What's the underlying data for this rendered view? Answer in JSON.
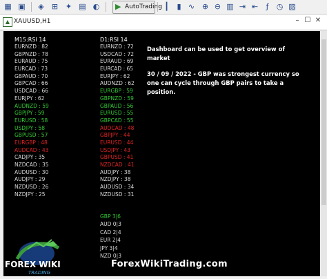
{
  "toolbar": {
    "autotrading_label": "AutoTrading"
  },
  "window": {
    "title": "XAUUSD,H1"
  },
  "dashboard": {
    "m15_header": "M15:RSI 14",
    "d1_header": "D1:RSI 14",
    "m15_rows": [
      {
        "text": "EURNZD : 82",
        "color": "white"
      },
      {
        "text": "GBPNZD : 78",
        "color": "white"
      },
      {
        "text": "EURAUD : 75",
        "color": "white"
      },
      {
        "text": "EURCAD : 73",
        "color": "white"
      },
      {
        "text": "GBPAUD : 70",
        "color": "white"
      },
      {
        "text": "GBPCAD : 66",
        "color": "white"
      },
      {
        "text": "USDCAD : 66",
        "color": "white"
      },
      {
        "text": "EURJPY : 62",
        "color": "white"
      },
      {
        "text": "AUDNZD : 59",
        "color": "green"
      },
      {
        "text": "GBPJPY : 59",
        "color": "green"
      },
      {
        "text": "EURUSD : 58",
        "color": "green"
      },
      {
        "text": "USDJPY : 58",
        "color": "green"
      },
      {
        "text": "GBPUSD : 57",
        "color": "green"
      },
      {
        "text": "EURGBP : 48",
        "color": "red"
      },
      {
        "text": "AUDCAD : 43",
        "color": "red"
      },
      {
        "text": "CADJPY : 35",
        "color": "white"
      },
      {
        "text": "NZDCAD : 35",
        "color": "white"
      },
      {
        "text": "AUDUSD : 30",
        "color": "white"
      },
      {
        "text": "AUDJPY : 29",
        "color": "white"
      },
      {
        "text": "NZDUSD : 26",
        "color": "white"
      },
      {
        "text": "NZDJPY : 25",
        "color": "white"
      }
    ],
    "d1_rows": [
      {
        "text": "EURNZD : 72",
        "color": "white"
      },
      {
        "text": "USDCAD : 72",
        "color": "white"
      },
      {
        "text": "EURAUD : 69",
        "color": "white"
      },
      {
        "text": "EURCAD : 65",
        "color": "white"
      },
      {
        "text": "EURJPY : 62",
        "color": "white"
      },
      {
        "text": "AUDNZD : 62",
        "color": "white"
      },
      {
        "text": "EURGBP : 59",
        "color": "green"
      },
      {
        "text": "GBPNZD : 59",
        "color": "green"
      },
      {
        "text": "GBPAUD : 56",
        "color": "green"
      },
      {
        "text": "EURUSD : 55",
        "color": "green"
      },
      {
        "text": "GBPCAD : 55",
        "color": "green"
      },
      {
        "text": "AUDCAD : 48",
        "color": "red"
      },
      {
        "text": "GBPJPY : 44",
        "color": "red"
      },
      {
        "text": "EURUSD : 44",
        "color": "red"
      },
      {
        "text": "USDJPY : 43",
        "color": "red"
      },
      {
        "text": "GBPUSD : 41",
        "color": "red"
      },
      {
        "text": "NZDCAD : 41",
        "color": "red"
      },
      {
        "text": "AUDJPY : 38",
        "color": "white"
      },
      {
        "text": "NZDJPY : 38",
        "color": "white"
      },
      {
        "text": "AUDUSD : 34",
        "color": "white"
      },
      {
        "text": "NZDUSD : 31",
        "color": "white"
      }
    ],
    "strength_rows": [
      {
        "text": "GBP 3|6",
        "color": "green"
      },
      {
        "text": "AUD 0|3",
        "color": "white"
      },
      {
        "text": "CAD 2|4",
        "color": "white"
      },
      {
        "text": "EUR 2|4",
        "color": "white"
      },
      {
        "text": "JPY 3|4",
        "color": "white"
      },
      {
        "text": "NZD 0|3",
        "color": "white"
      }
    ]
  },
  "note": {
    "line1": "Dashboard can be used to get overview of market",
    "line2": "30 / 09 / 2022 -  GBP was strongest currency so one can cycle through GBP pairs to take a position."
  },
  "logo": {
    "text": "FOREX WIKI TRADING"
  },
  "watermark": "ForexWikiTrading.com",
  "colors": {
    "chart_bg": "#000000",
    "text_white": "#d8d8d8",
    "text_green": "#34c834",
    "text_red": "#e02424"
  }
}
